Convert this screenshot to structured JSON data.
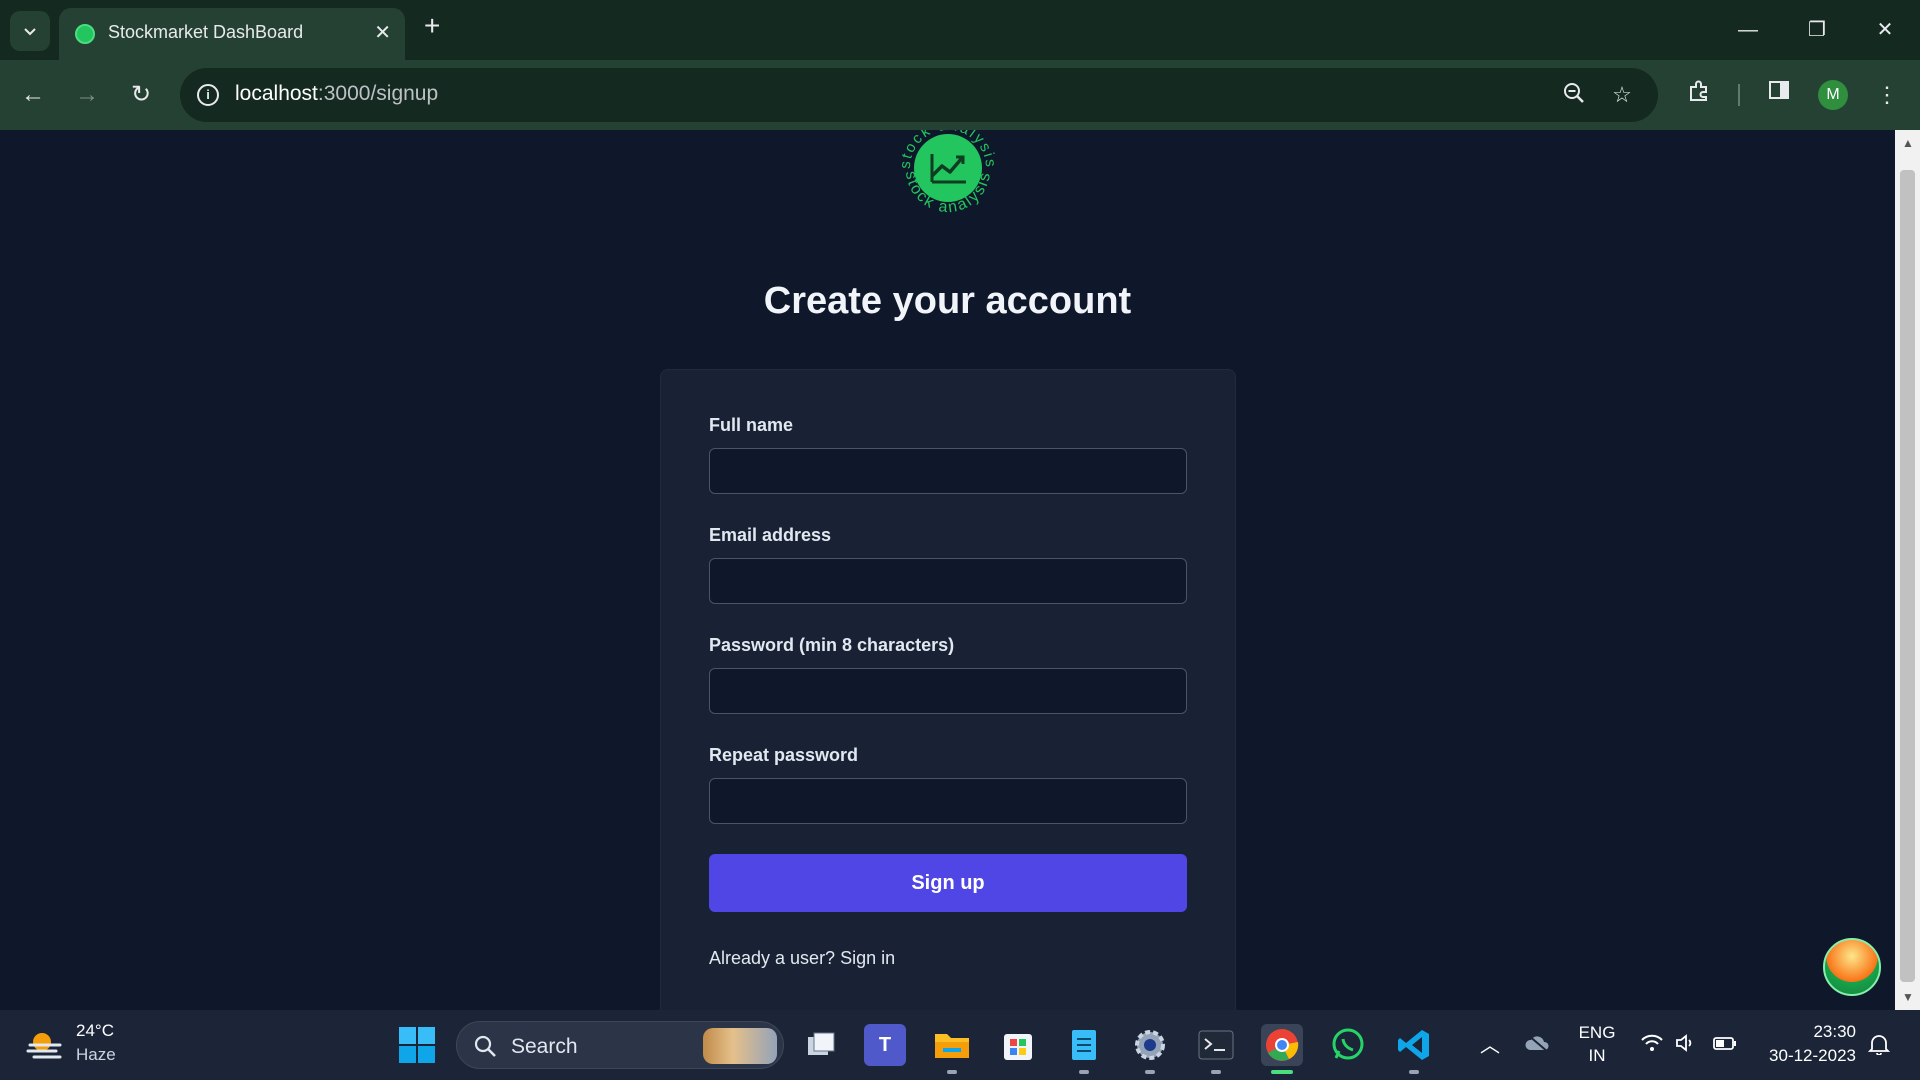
{
  "browser": {
    "tab_title": "Stockmarket DashBoard",
    "url_host": "localhost",
    "url_path": ":3000/signup",
    "profile_initial": "M"
  },
  "page": {
    "logo": {
      "text_top": "stock analysis",
      "text_bottom": "stock analysis"
    },
    "title": "Create your account",
    "form": {
      "full_name_label": "Full name",
      "full_name_value": "",
      "email_label": "Email address",
      "email_value": "",
      "password_label": "Password (min 8 characters)",
      "password_value": "",
      "repeat_password_label": "Repeat password",
      "repeat_password_value": "",
      "submit_label": "Sign up",
      "signin_prompt": "Already a user? Sign in"
    }
  },
  "taskbar": {
    "weather_temp": "24°C",
    "weather_desc": "Haze",
    "search_placeholder": "Search",
    "apps": [
      "task-view",
      "teams",
      "file-explorer",
      "microsoft-store",
      "notepad",
      "settings",
      "terminal",
      "chrome",
      "whatsapp",
      "vs-code"
    ],
    "active_app": "chrome",
    "language_line1": "ENG",
    "language_line2": "IN",
    "time": "23:30",
    "date": "30-12-2023"
  },
  "colors": {
    "page_bg": "#0f172a",
    "card_bg": "#182234",
    "accent": "#4f46e5",
    "brand_green": "#22c55e",
    "chrome_dark": "#14291f",
    "chrome_toolbar": "#254134"
  }
}
